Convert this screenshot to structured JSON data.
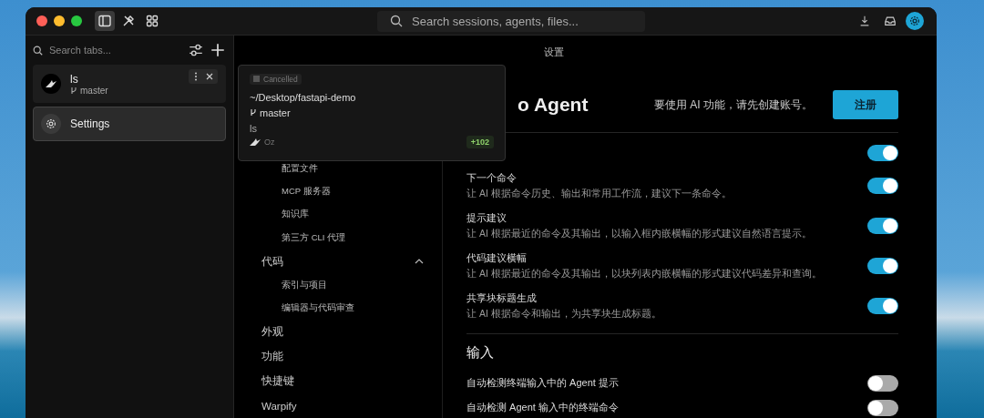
{
  "titlebar": {
    "left_buttons": [
      {
        "kind": "sidebar",
        "selected": true
      },
      {
        "kind": "tools",
        "selected": false
      },
      {
        "kind": "grid",
        "selected": false
      }
    ],
    "search": {
      "placeholder": "Search sessions, agents, files..."
    },
    "right_buttons": [
      {
        "kind": "download",
        "selected": false
      },
      {
        "kind": "inbox",
        "selected": false
      },
      {
        "kind": "settings",
        "selected": true
      }
    ]
  },
  "sidebar": {
    "search": {
      "placeholder": "Search tabs..."
    },
    "tabs": [
      {
        "kind": "session",
        "title": "ls",
        "branch": "master",
        "selected": false
      },
      {
        "kind": "settings",
        "title": "Settings",
        "selected": true
      }
    ]
  },
  "popup": {
    "status": "Cancelled",
    "path": "~/Desktop/fastapi-demo",
    "branch": "master",
    "command": "ls",
    "agent": "Oz",
    "diff": "+102"
  },
  "main": {
    "title": "设置",
    "nav": [
      {
        "children": [
          {
            "label": "配置文件"
          },
          {
            "label": "MCP 服务器"
          },
          {
            "label": "知识库"
          },
          {
            "label": "第三方 CLI 代理"
          }
        ]
      },
      {
        "label": "代码",
        "expanded": true,
        "children": [
          {
            "label": "索引与项目"
          },
          {
            "label": "编辑器与代码审查"
          }
        ]
      },
      {
        "label": "外观"
      },
      {
        "label": "功能"
      },
      {
        "label": "快捷键"
      },
      {
        "label": "Warpify"
      }
    ],
    "heading": "o Agent",
    "notice": "要使用 AI 功能，请先创建账号。",
    "signup_button": "注册",
    "sections": [
      {
        "rows": [
          {
            "on": true
          },
          {
            "label": "下一个命令",
            "description": "让 AI 根据命令历史、输出和常用工作流，建议下一条命令。",
            "on": true
          },
          {
            "label": "提示建议",
            "description": "让 AI 根据最近的命令及其输出，以输入框内嵌横幅的形式建议自然语言提示。",
            "on": true
          },
          {
            "label": "代码建议横幅",
            "description": "让 AI 根据最近的命令及其输出，以块列表内嵌横幅的形式建议代码差异和查询。",
            "on": true
          },
          {
            "label": "共享块标题生成",
            "description": "让 AI 根据命令和输出，为共享块生成标题。",
            "on": true
          }
        ]
      },
      {
        "title": "输入",
        "rows": [
          {
            "label": "自动检测终端输入中的 Agent 提示",
            "on": false
          },
          {
            "label": "自动检测 Agent 输入中的终端命令",
            "on": false
          }
        ]
      }
    ]
  }
}
